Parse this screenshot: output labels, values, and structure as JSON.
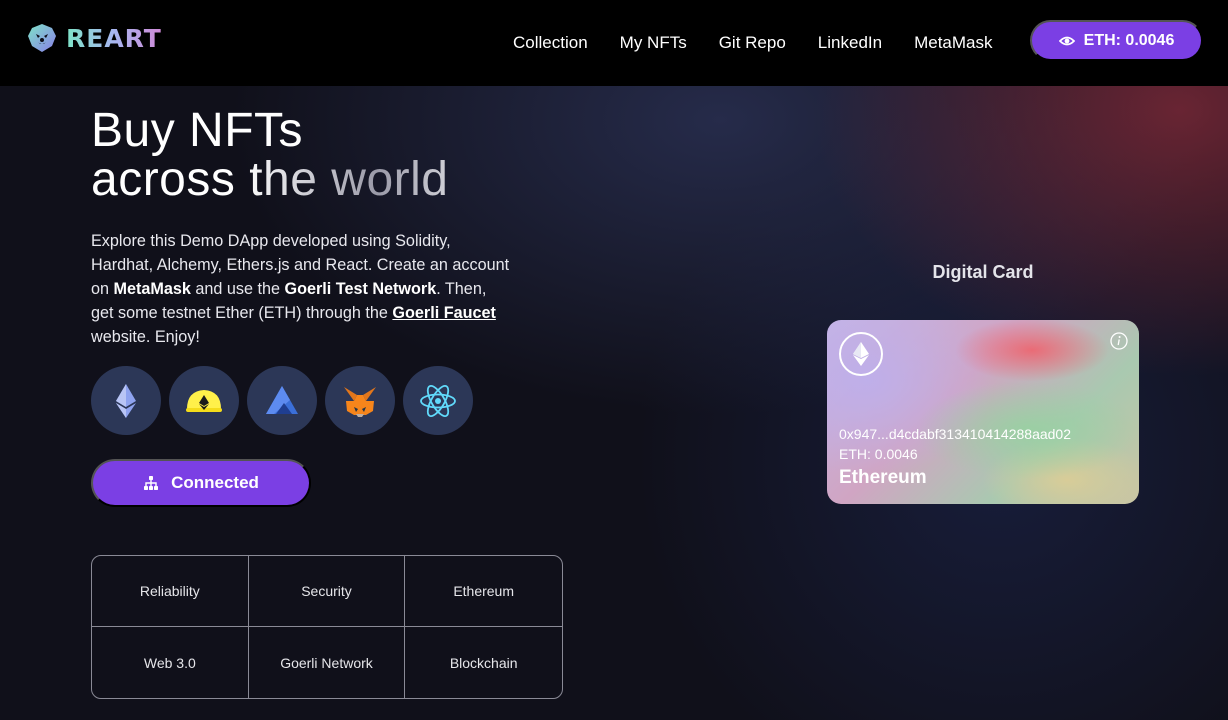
{
  "nav": {
    "brand": "REART",
    "links": [
      "Collection",
      "My NFTs",
      "Git Repo",
      "LinkedIn",
      "MetaMask"
    ],
    "eth_button": "ETH: 0.0046"
  },
  "hero": {
    "title_line1": "Buy NFTs",
    "title_line2": "across the world",
    "desc_1": "Explore this Demo DApp developed using Solidity, Hardhat, Alchemy, Ethers.js and React. Create an account on ",
    "desc_metamask": "MetaMask",
    "desc_2": " and use the ",
    "desc_goerli": "Goerli Test Network",
    "desc_3": ". Then, get some testnet Ether (ETH) through the ",
    "desc_faucet": "Goerli Faucet",
    "desc_4": " website. Enjoy!",
    "tech_icons": [
      "ethereum-icon",
      "hardhat-icon",
      "alchemy-icon",
      "metamask-icon",
      "react-icon"
    ],
    "connect_button": "Connected"
  },
  "features": [
    "Reliability",
    "Security",
    "Ethereum",
    "Web 3.0",
    "Goerli Network",
    "Blockchain"
  ],
  "card": {
    "heading": "Digital Card",
    "address": "0x947...d4cdabf313410414288aad02",
    "balance": "ETH: 0.0046",
    "network": "Ethereum"
  },
  "colors": {
    "accent": "#7b3fe4",
    "navbar": "#000000",
    "icon_circle": "#2c3757"
  }
}
